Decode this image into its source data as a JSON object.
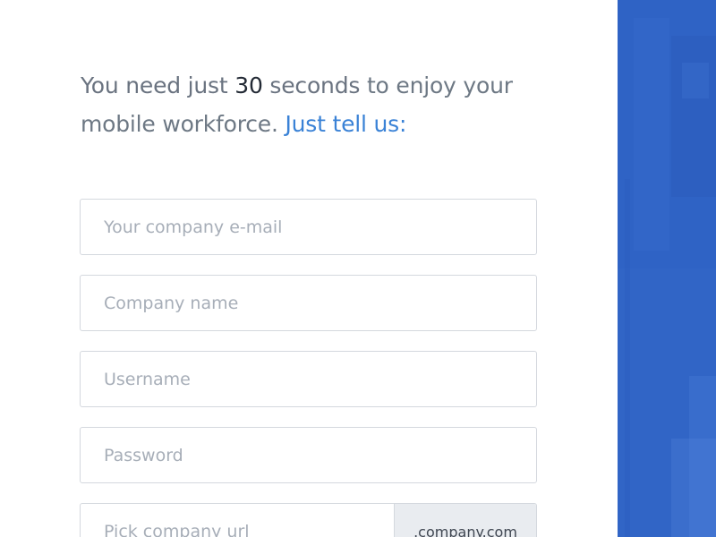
{
  "intro": {
    "part1": "You need just ",
    "number": "30",
    "part2": " seconds",
    "part3": " to enjoy your mobile workforce.",
    "cta": " Just tell us:"
  },
  "form": {
    "email": {
      "placeholder": "Your company e-mail",
      "value": ""
    },
    "company_name": {
      "placeholder": "Company name",
      "value": ""
    },
    "username": {
      "placeholder": "Username",
      "value": ""
    },
    "password": {
      "placeholder": "Password",
      "value": ""
    },
    "company_url": {
      "placeholder": "Pick company url",
      "value": "",
      "suffix": ".company.com"
    }
  },
  "colors": {
    "accent": "#3a82d6",
    "hero_blue": "#2f63c5",
    "field_border": "#d4d8de",
    "suffix_bg": "#e9ecf0"
  }
}
